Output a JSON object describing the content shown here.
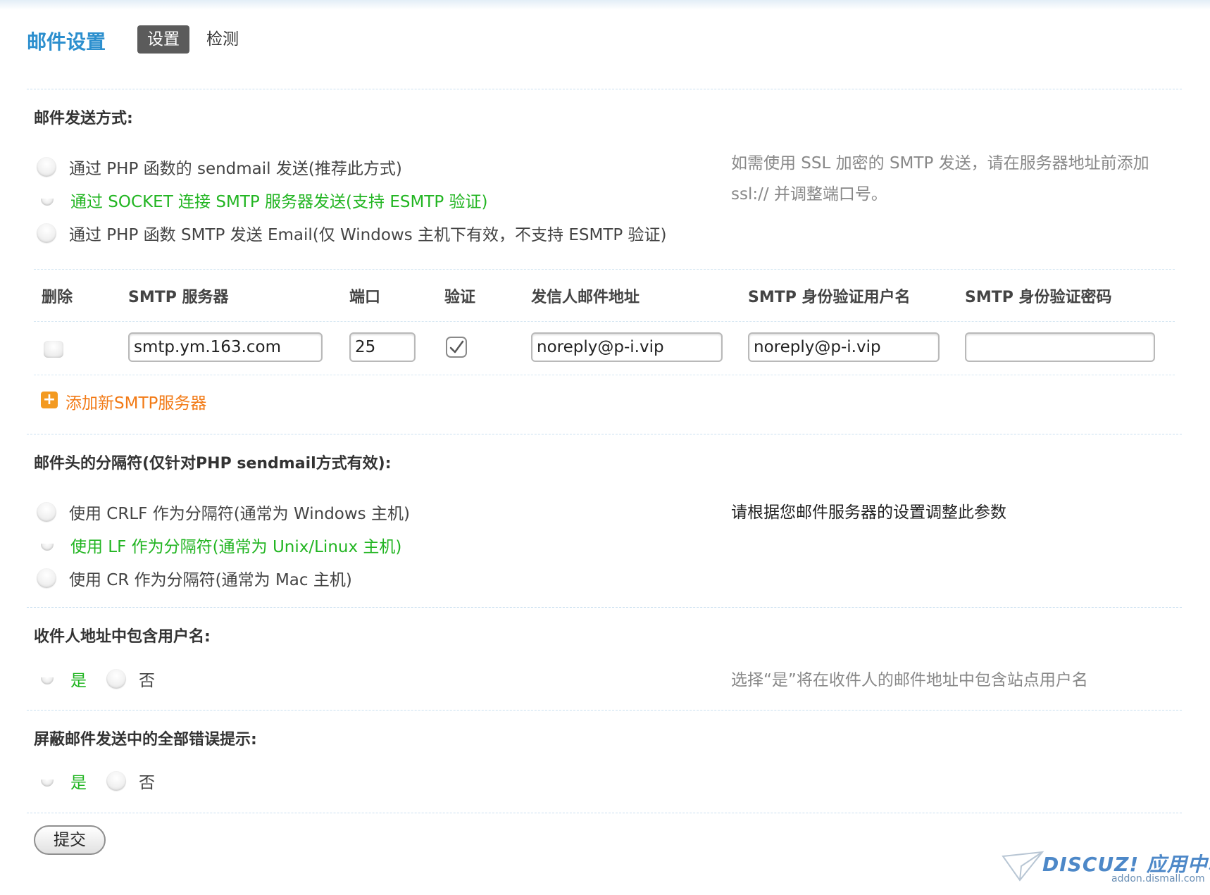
{
  "header": {
    "title": "邮件设置",
    "tabs": [
      {
        "label": "设置",
        "active": true
      },
      {
        "label": "检测",
        "active": false
      }
    ]
  },
  "send_method": {
    "label": "邮件发送方式:",
    "options": [
      {
        "label": "通过 PHP 函数的 sendmail 发送(推荐此方式)",
        "checked": false
      },
      {
        "label": "通过 SOCKET 连接 SMTP 服务器发送(支持 ESMTP 验证)",
        "checked": true
      },
      {
        "label": "通过 PHP 函数 SMTP 发送 Email(仅 Windows 主机下有效，不支持 ESMTP 验证)",
        "checked": false
      }
    ],
    "hint": "如需使用 SSL 加密的 SMTP 发送，请在服务器地址前添加 ssl:// 并调整端口号。"
  },
  "smtp_table": {
    "headers": {
      "delete": "删除",
      "server": "SMTP 服务器",
      "port": "端口",
      "auth": "验证",
      "from": "发信人邮件地址",
      "username": "SMTP 身份验证用户名",
      "password": "SMTP 身份验证密码"
    },
    "rows": [
      {
        "delete_checked": false,
        "server": "smtp.ym.163.com",
        "port": "25",
        "auth_checked": true,
        "from": "noreply@p-i.vip",
        "username": "noreply@p-i.vip",
        "password": ""
      }
    ],
    "add_label": "添加新SMTP服务器"
  },
  "separator": {
    "label": "邮件头的分隔符(仅针对PHP sendmail方式有效):",
    "options": [
      {
        "label": "使用 CRLF 作为分隔符(通常为 Windows 主机)",
        "checked": false
      },
      {
        "label": "使用 LF 作为分隔符(通常为 Unix/Linux 主机)",
        "checked": true
      },
      {
        "label": "使用 CR 作为分隔符(通常为 Mac 主机)",
        "checked": false
      }
    ],
    "hint": "请根据您邮件服务器的设置调整此参数"
  },
  "include_username": {
    "label": "收件人地址中包含用户名:",
    "yes": "是",
    "no": "否",
    "value": "yes",
    "hint": "选择“是”将在收件人的邮件地址中包含站点用户名"
  },
  "silent_errors": {
    "label": "屏蔽邮件发送中的全部错误提示:",
    "yes": "是",
    "no": "否",
    "value": "yes"
  },
  "submit_label": "提交",
  "watermark": {
    "brand": "DISCUZ! 应用中心",
    "url": "addon.dismall.com"
  }
}
